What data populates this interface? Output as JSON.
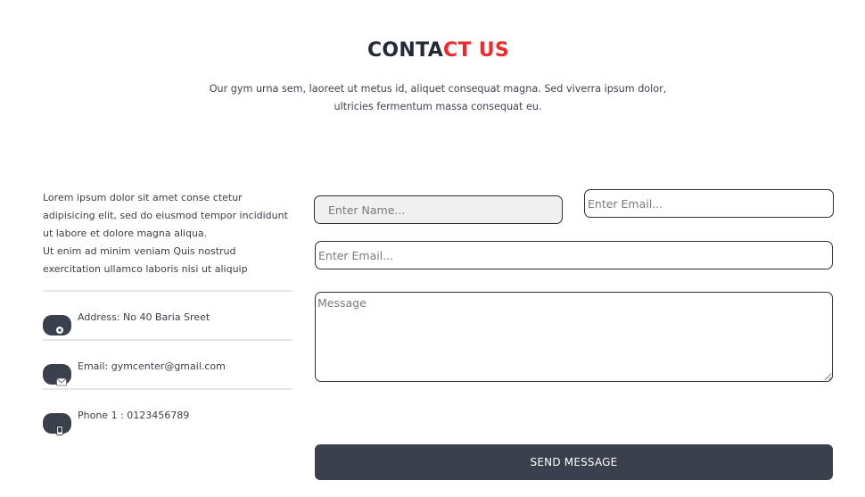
{
  "section": {
    "title_part1": "CONTA",
    "title_part2": "CT US",
    "subtitle_line1": "Our gym urna sem, laoreet ut metus id, aliquet consequat magna. Sed viverra ipsum dolor,",
    "subtitle_line2": "ultricies fermentum massa consequat eu."
  },
  "intro": {
    "line1": "Lorem ipsum dolor sit amet conse ctetur",
    "line2": "adipisicing elit, sed do eiusmod tempor incididunt",
    "line3": "ut labore et dolore magna aliqua.",
    "line4": "Ut enim ad minim veniam Quis nostrud",
    "line5": "exercitation ullamco laboris nisi ut aliquip"
  },
  "contact_info": [
    {
      "icon": "map-pin-icon",
      "text": "Address: No 40 Baria Sreet"
    },
    {
      "icon": "envelope-icon",
      "text": "Email: gymcenter@gmail.com"
    },
    {
      "icon": "phone-icon",
      "text": "Phone 1 : 0123456789"
    }
  ],
  "form": {
    "name_placeholder": "Enter Name...",
    "email_placeholder": "Enter Email...",
    "email2_placeholder": "Enter Email...",
    "message_placeholder": "Message",
    "submit_label": "SEND MESSAGE"
  },
  "colors": {
    "accent": "#ee2a2a",
    "dark": "#3a404c",
    "heading": "#232a36"
  }
}
